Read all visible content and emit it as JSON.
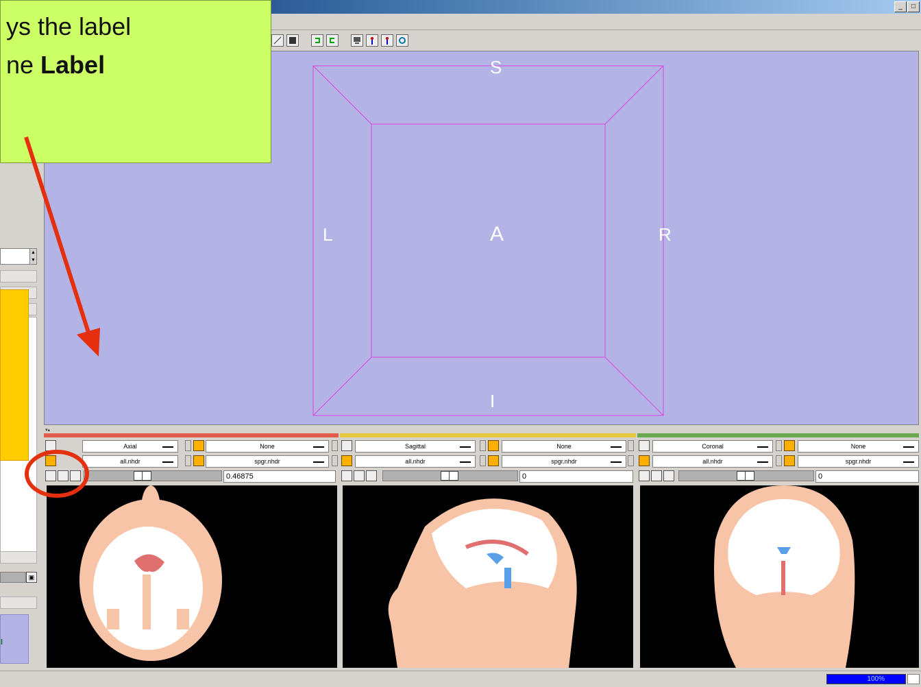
{
  "callout": {
    "line1": "ys  the label",
    "line2_prefix": "ne ",
    "line2_bold": "Label"
  },
  "window": {
    "min": "_",
    "max": "□"
  },
  "view3d": {
    "labels": {
      "top": "S",
      "bottom": "I",
      "left": "R",
      "right": "L",
      "center": "A"
    },
    "colors": {
      "background": "#b3b3e6",
      "box": "#dd44dd"
    }
  },
  "slices": [
    {
      "name": "Axial",
      "fg": "None",
      "label": "all.nhdr",
      "bg": "spgr.nhdr",
      "value": "0.46875",
      "color": "#e25a4a",
      "slider": 0.42
    },
    {
      "name": "Sagittal",
      "fg": "None",
      "label": "all.nhdr",
      "bg": "spgr.nhdr",
      "value": "0",
      "color": "#e8c840",
      "slider": 0.5
    },
    {
      "name": "Coronal",
      "fg": "None",
      "label": "all.nhdr",
      "bg": "spgr.nhdr",
      "value": "0",
      "color": "#6aa84f",
      "slider": 0.5
    }
  ],
  "status": {
    "progress": "100%",
    "progress_value": 1.0
  },
  "icons": [
    "layout-icon",
    "grid-icon",
    "undo-icon",
    "redo-icon",
    "screenshot-icon",
    "pin-icon",
    "pin-alt-icon",
    "refresh-icon"
  ]
}
